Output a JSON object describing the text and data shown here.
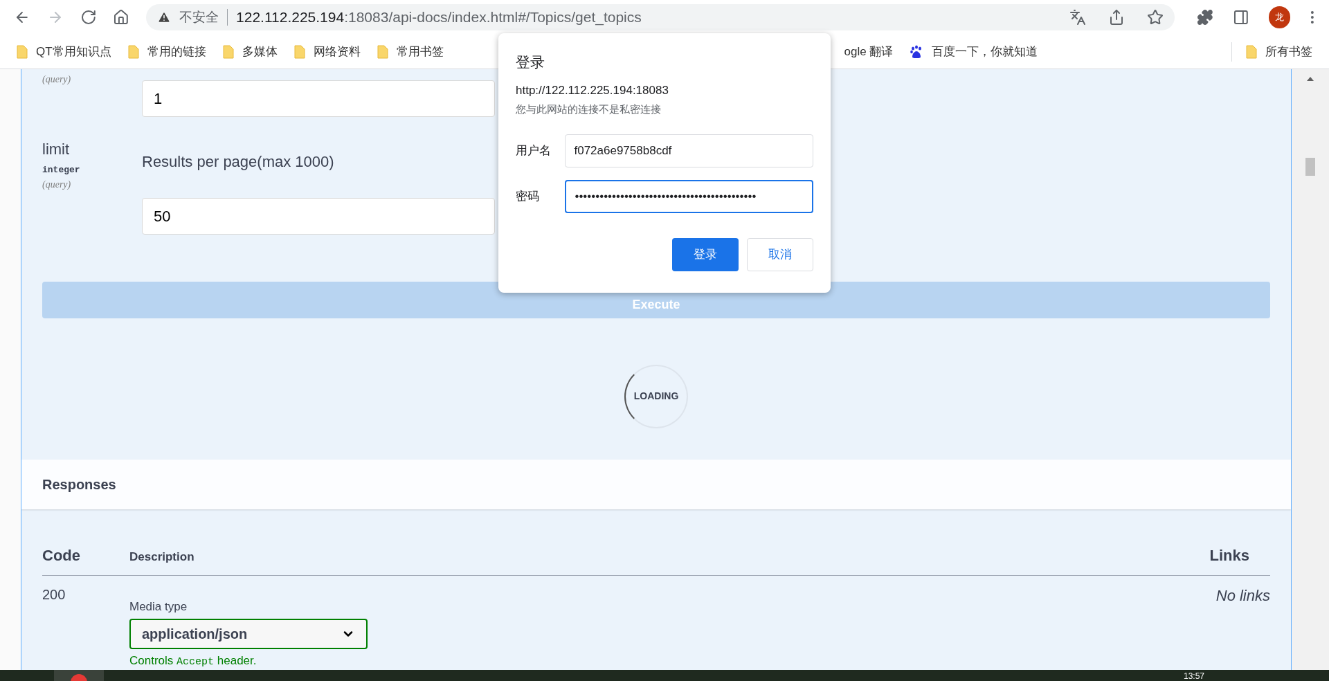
{
  "browser": {
    "security_label": "不安全",
    "url_host": "122.112.225.194",
    "url_rest": ":18083/api-docs/index.html#/Topics/get_topics",
    "avatar": "龙"
  },
  "bookmarks": [
    {
      "label": "QT常用知识点",
      "kind": "folder"
    },
    {
      "label": "常用的链接",
      "kind": "folder"
    },
    {
      "label": "多媒体",
      "kind": "folder"
    },
    {
      "label": "网络资料",
      "kind": "folder"
    },
    {
      "label": "常用书签",
      "kind": "folder"
    }
  ],
  "bookmarks_cut": [
    {
      "label": "ogle 翻译",
      "kind": "plain"
    },
    {
      "label": "百度一下，你就知道",
      "kind": "baidu"
    }
  ],
  "bookmarks_right": {
    "label": "所有书签"
  },
  "params": [
    {
      "in": "(query)",
      "value": "1"
    },
    {
      "name": "limit",
      "type": "integer",
      "in": "(query)",
      "description": "Results per page(max 1000)",
      "value": "50"
    }
  ],
  "execute": "Execute",
  "loading": "LOADING",
  "responses": {
    "title": "Responses",
    "columns": [
      "Code",
      "Description",
      "Links"
    ],
    "rows": [
      {
        "code": "200",
        "media_label": "Media type",
        "media_type": "application/json",
        "note_before": "Controls",
        "note_code": "Accept",
        "note_after": "header.",
        "links": "No links"
      }
    ]
  },
  "dialog": {
    "title": "登录",
    "origin": "http://122.112.225.194:18083",
    "warning": "您与此网站的连接不是私密连接",
    "fields": [
      {
        "label": "用户名",
        "value": "f072a6e9758b8cdf",
        "focused": false
      },
      {
        "label": "密码",
        "value": "••••••••••••••••••••••••••••••••••••••••••••",
        "focused": true
      }
    ],
    "buttons": [
      {
        "label": "登录",
        "kind": "primary"
      },
      {
        "label": "取消",
        "kind": "secondary"
      }
    ]
  },
  "taskbar": {
    "time": "13:57"
  }
}
